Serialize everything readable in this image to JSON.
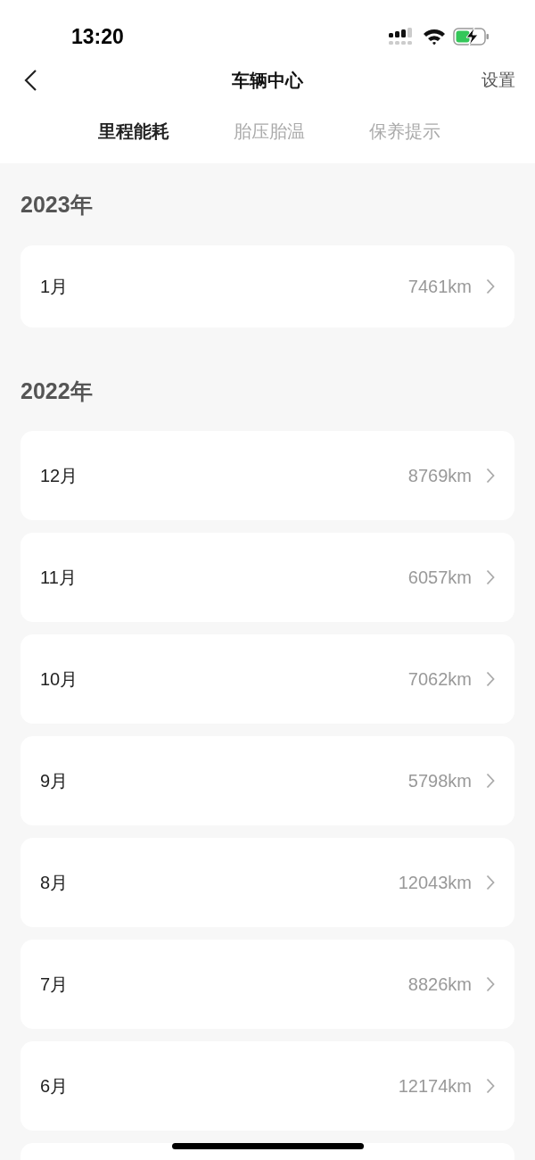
{
  "status_bar": {
    "time": "13:20"
  },
  "header": {
    "title": "车辆中心",
    "action": "设置"
  },
  "tabs": [
    {
      "label": "里程能耗",
      "selected": true
    },
    {
      "label": "胎压胎温",
      "selected": false
    },
    {
      "label": "保养提示",
      "selected": false
    }
  ],
  "sections": [
    {
      "year": "2023年",
      "rows": [
        {
          "month": "1月",
          "distance": "7461km"
        }
      ]
    },
    {
      "year": "2022年",
      "rows": [
        {
          "month": "12月",
          "distance": "8769km"
        },
        {
          "month": "11月",
          "distance": "6057km"
        },
        {
          "month": "10月",
          "distance": "7062km"
        },
        {
          "month": "9月",
          "distance": "5798km"
        },
        {
          "month": "8月",
          "distance": "12043km"
        },
        {
          "month": "7月",
          "distance": "8826km"
        },
        {
          "month": "6月",
          "distance": "12174km"
        }
      ]
    }
  ]
}
